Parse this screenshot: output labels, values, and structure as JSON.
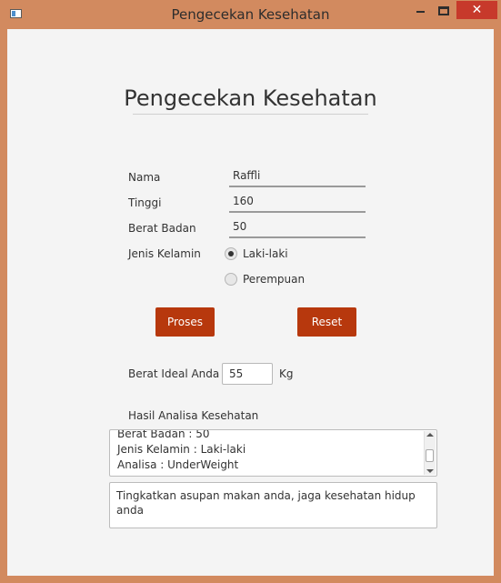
{
  "window": {
    "title": "Pengecekan Kesehatan",
    "close_glyph": "✕"
  },
  "form": {
    "heading": "Pengecekan Kesehatan",
    "nama_label": "Nama",
    "nama_value": "Raffli",
    "tinggi_label": "Tinggi",
    "tinggi_value": "160",
    "berat_label": "Berat Badan",
    "berat_value": "50",
    "gender_label": "Jenis Kelamin",
    "gender_options": [
      {
        "label": "Laki-laki",
        "selected": true
      },
      {
        "label": "Perempuan",
        "selected": false
      }
    ]
  },
  "buttons": {
    "proses": "Proses",
    "reset": "Reset"
  },
  "result": {
    "ideal_label": "Berat Ideal Anda",
    "ideal_value": "55",
    "ideal_unit": "Kg",
    "analysis_label": "Hasil Analisa Kesehatan",
    "analysis_lines": [
      "Berat Badan : 50",
      "Jenis Kelamin : Laki-laki",
      "Analisa : UnderWeight"
    ],
    "advice": "Tingkatkan asupan makan anda, jaga kesehatan hidup anda"
  },
  "colors": {
    "window_border": "#d28a5f",
    "button_bg": "#b7380d",
    "close_bg": "#c7392b"
  }
}
